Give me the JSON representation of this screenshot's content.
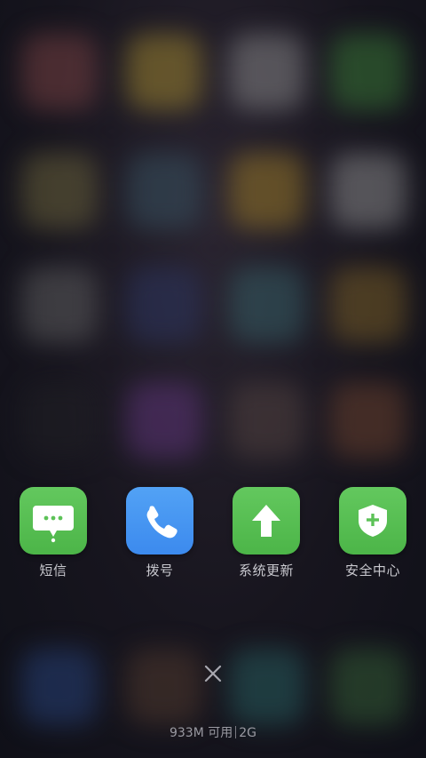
{
  "dock": {
    "apps": [
      {
        "label": "短信",
        "icon": "message-icon",
        "color": "#5cc257"
      },
      {
        "label": "拨号",
        "icon": "phone-icon",
        "color": "#4894f2"
      },
      {
        "label": "系统更新",
        "icon": "arrow-up-icon",
        "color": "#5cc257"
      },
      {
        "label": "安全中心",
        "icon": "shield-plus-icon",
        "color": "#5cc257"
      }
    ]
  },
  "footer": {
    "memory_text": "933M 可用",
    "network_text": "2G"
  },
  "close_icon": "close-icon"
}
